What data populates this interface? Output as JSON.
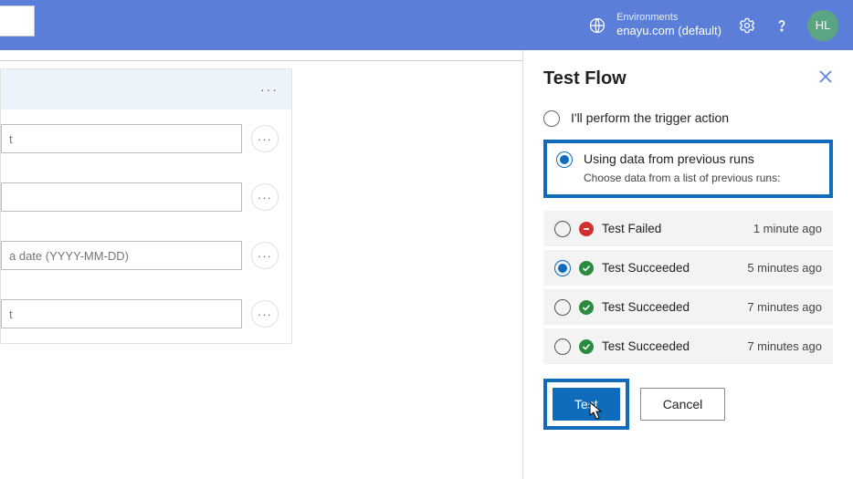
{
  "header": {
    "env_label": "Environments",
    "env_value": "enayu.com (default)",
    "avatar_initials": "HL"
  },
  "left": {
    "inputs": [
      {
        "placeholder": "t"
      },
      {
        "placeholder": ""
      },
      {
        "placeholder": "a date (YYYY-MM-DD)"
      },
      {
        "placeholder": "t"
      }
    ]
  },
  "panel": {
    "title": "Test Flow",
    "opt_manual": "I'll perform the trigger action",
    "opt_prev": "Using data from previous runs",
    "opt_prev_sub": "Choose data from a list of previous runs:",
    "runs": [
      {
        "status": "fail",
        "name": "Test Failed",
        "ts": "1 minute ago",
        "selected": false
      },
      {
        "status": "ok",
        "name": "Test Succeeded",
        "ts": "5 minutes ago",
        "selected": true
      },
      {
        "status": "ok",
        "name": "Test Succeeded",
        "ts": "7 minutes ago",
        "selected": false
      },
      {
        "status": "ok",
        "name": "Test Succeeded",
        "ts": "7 minutes ago",
        "selected": false
      }
    ],
    "btn_primary": "Test",
    "btn_secondary": "Cancel"
  }
}
